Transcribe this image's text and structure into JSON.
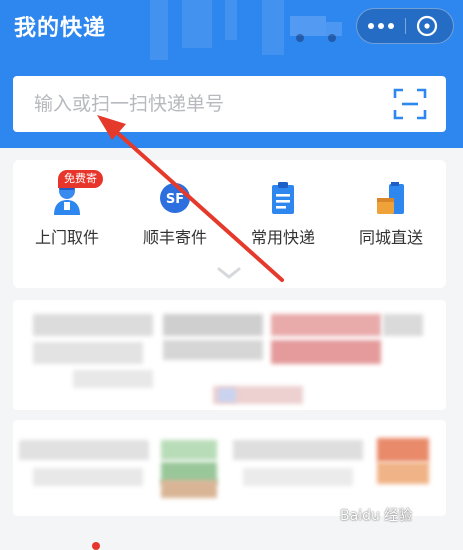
{
  "header": {
    "title": "我的快递"
  },
  "capsule": {
    "more_icon": "more-icon",
    "close_icon": "close-circle-icon"
  },
  "search": {
    "placeholder": "输入或扫一扫快递单号",
    "scan_icon": "scan-icon"
  },
  "services": [
    {
      "label": "上门取件",
      "icon": "courier-icon",
      "badge": "免费寄"
    },
    {
      "label": "顺丰寄件",
      "icon": "sf-logo-icon"
    },
    {
      "label": "常用快递",
      "icon": "clipboard-icon"
    },
    {
      "label": "同城直送",
      "icon": "city-delivery-icon"
    }
  ],
  "colors": {
    "primary": "#2e86ef",
    "badge": "#e8352b",
    "arrow": "#e53a2b"
  },
  "watermark": "Baidu 经验"
}
